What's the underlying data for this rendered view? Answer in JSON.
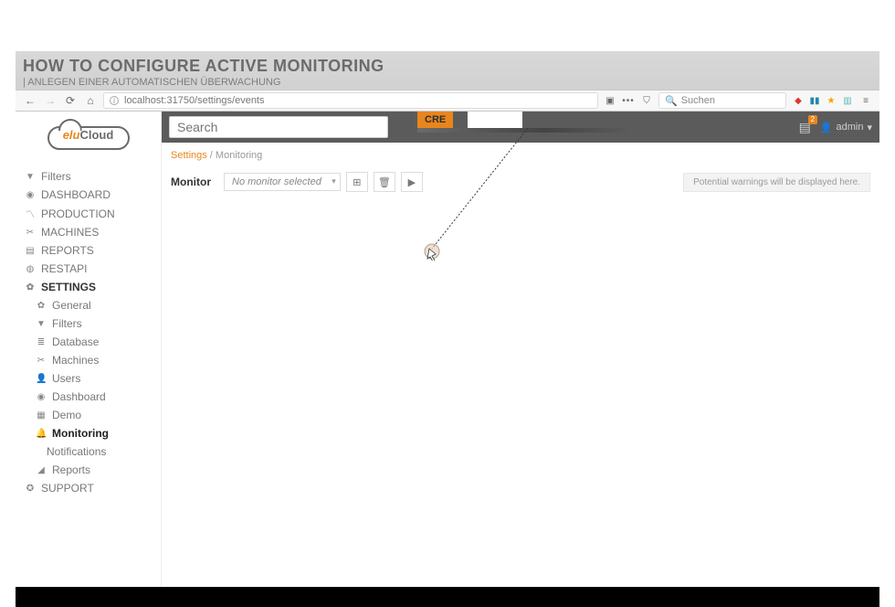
{
  "title_block": {
    "headline": "HOW TO CONFIGURE ACTIVE MONITORING",
    "subline": "| ANLEGEN EINER AUTOMATISCHEN ÜBERWACHUNG"
  },
  "browser": {
    "url": "localhost:31750/settings/events",
    "search_placeholder": "Suchen"
  },
  "branding": {
    "logo_prefix": "elu",
    "logo_word": "Cloud",
    "cre_tag": "CRE"
  },
  "nav": {
    "items": [
      {
        "icon": "▼",
        "label": "Filters"
      },
      {
        "icon": "◉",
        "label": "DASHBOARD"
      },
      {
        "icon": "〽",
        "label": "PRODUCTION"
      },
      {
        "icon": "✂",
        "label": "MACHINES"
      },
      {
        "icon": "▤",
        "label": "REPORTS"
      },
      {
        "icon": "◍",
        "label": "RESTAPI"
      }
    ],
    "settings_label": "SETTINGS",
    "settings_icon": "✿",
    "settings_children": [
      {
        "icon": "✿",
        "label": "General"
      },
      {
        "icon": "▼",
        "label": "Filters"
      },
      {
        "icon": "≣",
        "label": "Database"
      },
      {
        "icon": "✂",
        "label": "Machines"
      },
      {
        "icon": "👤",
        "label": "Users"
      },
      {
        "icon": "◉",
        "label": "Dashboard"
      },
      {
        "icon": "▦",
        "label": "Demo"
      },
      {
        "icon": "🔔",
        "label": "Monitoring",
        "active": true
      },
      {
        "icon": "",
        "label": "Notifications",
        "subsub": true
      },
      {
        "icon": "◢",
        "label": "Reports"
      }
    ],
    "support_label": "SUPPORT",
    "support_icon": "✪"
  },
  "topbar": {
    "search_placeholder": "Search",
    "user_label": "admin",
    "message_count": "2"
  },
  "breadcrumb": {
    "root": "Settings",
    "sep": " / ",
    "leaf": "Monitoring"
  },
  "monitor_toolbar": {
    "label": "Monitor",
    "selected_text": "No monitor selected",
    "hint": "Potential warnings will be displayed here."
  }
}
